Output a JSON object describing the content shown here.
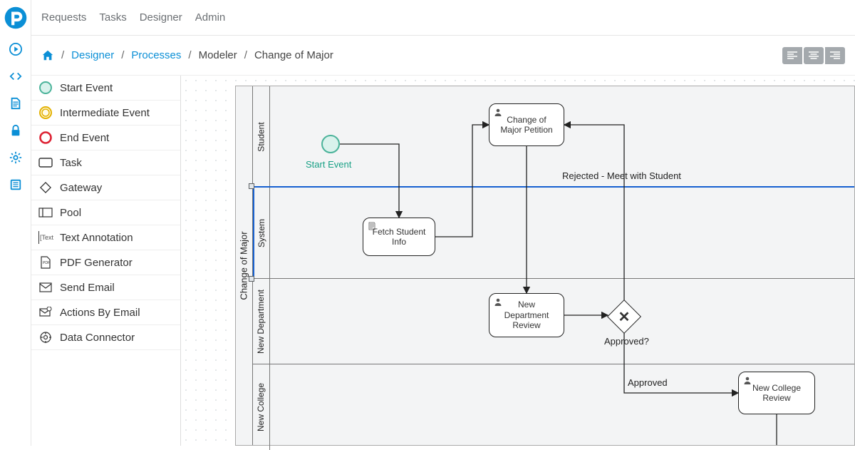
{
  "nav": {
    "requests": "Requests",
    "tasks": "Tasks",
    "designer": "Designer",
    "admin": "Admin"
  },
  "breadcrumb": {
    "designer": "Designer",
    "processes": "Processes",
    "modeler": "Modeler",
    "current": "Change of Major"
  },
  "palette": {
    "start_event": "Start Event",
    "intermediate_event": "Intermediate Event",
    "end_event": "End Event",
    "task": "Task",
    "gateway": "Gateway",
    "pool": "Pool",
    "text_annotation": "Text Annotation",
    "pdf_generator": "PDF Generator",
    "send_email": "Send Email",
    "actions_by_email": "Actions By Email",
    "data_connector": "Data Connector",
    "text_annotation_icon_text": "Text"
  },
  "diagram": {
    "pool_title": "Change of Major",
    "lanes": {
      "student": "Student",
      "system": "System",
      "new_department": "New Department",
      "new_college": "New College"
    },
    "start_event_label": "Start Event",
    "nodes": {
      "fetch_student_info": "Fetch Student\nInfo",
      "change_petition": "Change of\nMajor Petition",
      "new_dept_review": "New\nDepartment\nReview",
      "new_college_review": "New College\nReview"
    },
    "gateway_label": "Approved?",
    "flows": {
      "rejected": "Rejected - Meet with Student",
      "approved": "Approved"
    }
  }
}
